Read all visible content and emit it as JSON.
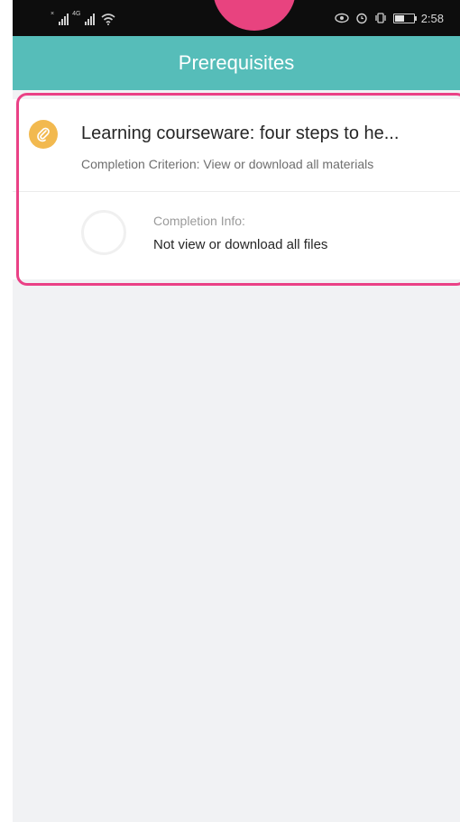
{
  "status_bar": {
    "time": "2:58",
    "left_icons": [
      "no-signal-icon",
      "signal-4g-icon",
      "wifi-icon"
    ],
    "right_icons": [
      "eye-icon",
      "alarm-icon",
      "vibrate-icon",
      "battery-icon"
    ]
  },
  "header": {
    "title": "Prerequisites",
    "bg_color": "#56bdb9"
  },
  "prerequisite": {
    "icon": "paperclip-icon",
    "title": "Learning courseware: four steps to he...",
    "criterion": "Completion Criterion: View or download all materials",
    "completion_label": "Completion Info:",
    "completion_value": "Not view or download all files",
    "progress": 0
  },
  "colors": {
    "highlight": "#ea4186",
    "icon_bg": "#f2b94f",
    "background": "#f1f2f4"
  }
}
